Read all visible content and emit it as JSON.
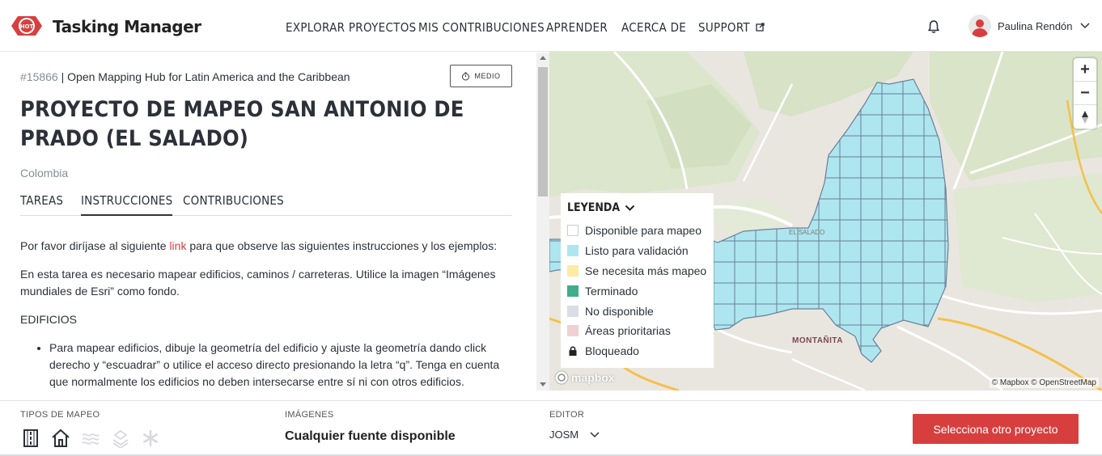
{
  "header": {
    "brand": "Tasking Manager",
    "logo_text": "HOT",
    "nav": [
      {
        "label": "EXPLORAR PROYECTOS"
      },
      {
        "label": "MIS CONTRIBUCIONES"
      },
      {
        "label": "APRENDER"
      },
      {
        "label": "ACERCA DE"
      },
      {
        "label": "SUPPORT"
      }
    ],
    "user_name": "Paulina Rendón"
  },
  "project": {
    "id": "#15866",
    "separator": " | ",
    "organization": "Open Mapping Hub for Latin America and the Caribbean",
    "difficulty": "MEDIO",
    "title": "PROYECTO DE MAPEO SAN ANTONIO DE PRADO (EL SALADO)",
    "country": "Colombia"
  },
  "tabs": [
    {
      "label": "TAREAS"
    },
    {
      "label": "INSTRUCCIONES"
    },
    {
      "label": "CONTRIBUCIONES"
    }
  ],
  "instructions": {
    "p1_before": "Por favor diríjase al siguiente ",
    "p1_link": "link",
    "p1_after": " para que observe las siguientes instrucciones y los ejemplos:",
    "p2": "En esta tarea es necesario mapear edificios, caminos / carreteras. Utilice la imagen “Imágenes mundiales de Esri” como fondo.",
    "p3": "EDIFICIOS",
    "li1": "Para mapear edificios, dibuje la geometría del edificio y ajuste la geometría dando click derecho y “escuadrar” o utilice el acceso directo presionando la letra “q”. Tenga en cuenta que normalmente los edificios no deben intersecarse entre sí ni con otros edificios."
  },
  "map": {
    "zoom_in": "+",
    "zoom_out": "−",
    "compass": "▲",
    "legend_title": "LEYENDA",
    "legend": [
      {
        "label": "Disponible para mapeo",
        "color": "#ffffff"
      },
      {
        "label": "Listo para validación",
        "color": "#ade6ef"
      },
      {
        "label": "Se necesita más mapeo",
        "color": "#fceca4"
      },
      {
        "label": "Terminado",
        "color": "#40ac8c"
      },
      {
        "label": "No disponible",
        "color": "#dadde6"
      },
      {
        "label": "Áreas prioritarias",
        "color": "#efd1d1"
      },
      {
        "label": "Bloqueado",
        "color": "lock"
      }
    ],
    "place_label_1": "MONTAÑITA",
    "place_label_2": "EL SALADO",
    "mapbox_label": "mapbox",
    "attribution": "© Mapbox © OpenStreetMap"
  },
  "footer": {
    "mapping_types_label": "TIPOS DE MAPEO",
    "imagery_label": "IMÁGENES",
    "imagery_value": "Cualquier fuente disponible",
    "editor_label": "EDITOR",
    "editor_value": "JOSM",
    "select_button": "Selecciona otro proyecto"
  },
  "colors": {
    "accent": "#d73f3f",
    "task_fill": "#ade6ef",
    "task_grid": "#6b7f9a"
  }
}
